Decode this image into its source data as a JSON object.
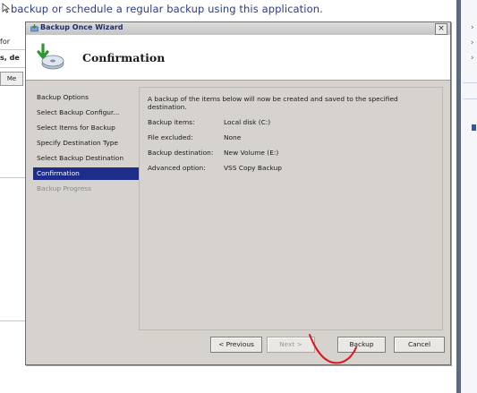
{
  "background_app": {
    "header_text": "backup or schedule a regular backup using this application.",
    "left_text_1": "for",
    "left_text_2": "s, de",
    "left_button": "Me"
  },
  "wizard": {
    "title": "Backup Once Wizard",
    "close_label": "×",
    "header_title": "Confirmation",
    "nav_items": [
      {
        "label": "Backup Options"
      },
      {
        "label": "Select Backup Configur..."
      },
      {
        "label": "Select Items for Backup"
      },
      {
        "label": "Specify Destination Type"
      },
      {
        "label": "Select Backup Destination"
      },
      {
        "label": "Confirmation"
      },
      {
        "label": "Backup Progress"
      }
    ],
    "intro": "A backup of the items below will now be created and saved to the specified destination.",
    "details": [
      {
        "label": "Backup items:",
        "value": "Local disk (C:)"
      },
      {
        "label": "File excluded:",
        "value": "None"
      },
      {
        "label": "Backup destination:",
        "value": "New Volume (E:)"
      },
      {
        "label": "Advanced option:",
        "value": "VSS Copy Backup"
      }
    ],
    "buttons": {
      "previous": "< Previous",
      "next": "Next >",
      "backup": "Backup",
      "cancel": "Cancel"
    }
  },
  "colors": {
    "active_nav_bg": "#1e2d8a",
    "annotation_red": "#e0141e",
    "dialog_bg": "#d6d3ce"
  },
  "icons": {
    "title": "backup-wizard-icon",
    "header": "backup-disk-icon",
    "close": "close-icon",
    "cursor": "mouse-cursor-icon"
  }
}
